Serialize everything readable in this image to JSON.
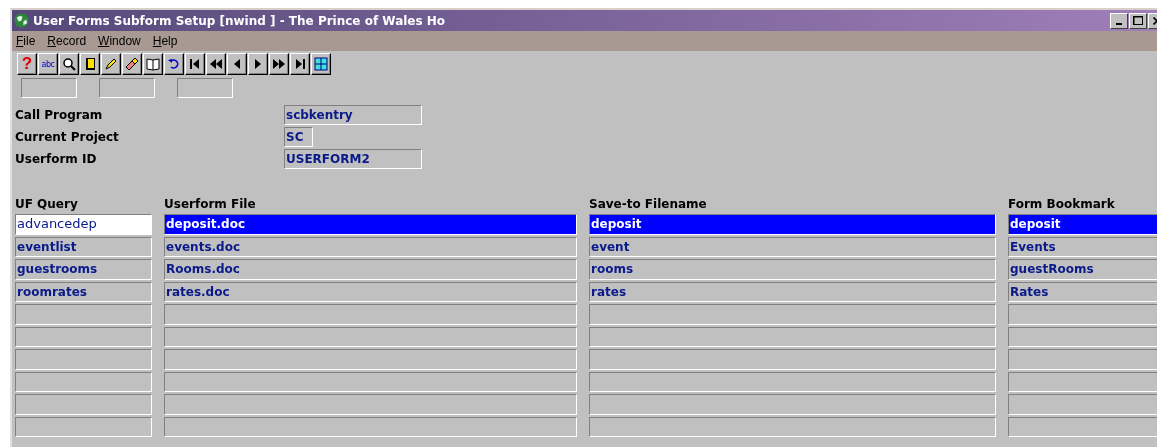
{
  "window": {
    "title": "User Forms Subform Setup [nwind   ] - The Prince of Wales Ho"
  },
  "menu": [
    {
      "label": "File"
    },
    {
      "label": "Record"
    },
    {
      "label": "Window"
    },
    {
      "label": "Help"
    }
  ],
  "toolbar": [
    {
      "kind": "help",
      "glyph": "?"
    },
    {
      "kind": "spell",
      "glyph": "abc"
    },
    {
      "kind": "search"
    },
    {
      "kind": "note"
    },
    {
      "kind": "highlight"
    },
    {
      "kind": "eraser"
    },
    {
      "kind": "book"
    },
    {
      "kind": "undo"
    },
    {
      "kind": "first"
    },
    {
      "kind": "prev-page"
    },
    {
      "kind": "prev"
    },
    {
      "kind": "next"
    },
    {
      "kind": "next-page"
    },
    {
      "kind": "last"
    },
    {
      "kind": "grid"
    }
  ],
  "fields": [
    {
      "label": "Call Program",
      "value": "scbkentry"
    },
    {
      "label": "Current Project",
      "value": "SC"
    },
    {
      "label": "Userform ID",
      "value": "USERFORM2"
    }
  ],
  "table": {
    "columns": [
      "UF Query",
      "Userform File",
      "Save-to Filename",
      "Form Bookmark"
    ],
    "rows": [
      {
        "selected": true,
        "cells": [
          {
            "text": "advancedep",
            "focused": true
          },
          {
            "text": "deposit.doc",
            "focused": false
          },
          {
            "text": "deposit",
            "focused": false
          },
          {
            "text": "deposit",
            "focused": false
          }
        ]
      },
      {
        "selected": false,
        "cells": [
          {
            "text": "eventlist",
            "focused": false
          },
          {
            "text": "events.doc",
            "focused": false
          },
          {
            "text": "event",
            "focused": false
          },
          {
            "text": "Events",
            "focused": false
          }
        ]
      },
      {
        "selected": false,
        "cells": [
          {
            "text": "guestrooms",
            "focused": false
          },
          {
            "text": "Rooms.doc",
            "focused": false
          },
          {
            "text": "rooms",
            "focused": false
          },
          {
            "text": "guestRooms",
            "focused": false
          }
        ]
      },
      {
        "selected": false,
        "cells": [
          {
            "text": "roomrates",
            "focused": false
          },
          {
            "text": "rates.doc",
            "focused": false
          },
          {
            "text": "rates",
            "focused": false
          },
          {
            "text": "Rates",
            "focused": false
          }
        ]
      }
    ]
  }
}
